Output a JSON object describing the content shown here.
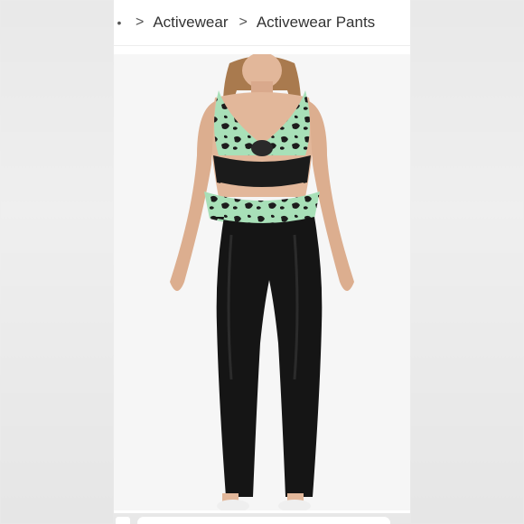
{
  "breadcrumb": {
    "dot": "•",
    "separator": ">",
    "items": [
      {
        "label": "Activewear"
      },
      {
        "label": "Activewear Pants"
      }
    ]
  },
  "colors": {
    "print_mint": "#a8e0b8",
    "print_dark": "#1c1c1c",
    "leggings": "#151515",
    "skin": "#e2b79a"
  }
}
